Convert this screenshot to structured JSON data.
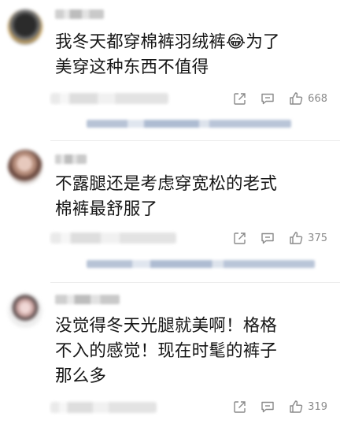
{
  "comments": [
    {
      "text": "我冬天都穿棉裤羽绒裤😂为了\n美穿这种东西不值得",
      "likes": "668"
    },
    {
      "text": "不露腿还是考虑穿宽松的老式\n棉裤最舒服了",
      "likes": "375"
    },
    {
      "text": "没觉得冬天光腿就美啊！格格\n不入的感觉！现在时髦的裤子\n那么多",
      "likes": "319"
    }
  ],
  "icons": {
    "share": "share-icon",
    "comment": "comment-icon",
    "like": "thumbs-up-icon"
  },
  "colors": {
    "icon_gray": "#8a8a8a",
    "reply_blue": "#b7c3d6"
  }
}
